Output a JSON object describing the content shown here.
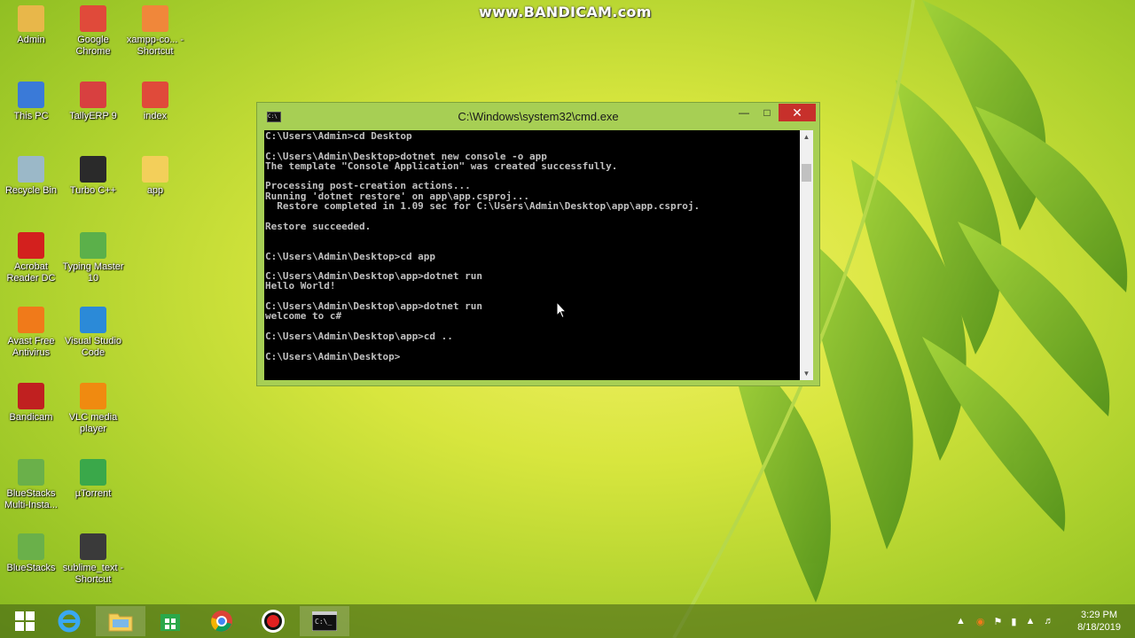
{
  "watermark": "www.BANDICAM.com",
  "desktop_icons": [
    {
      "label": "Admin",
      "icon": "user-folder-icon",
      "color": "#e8b74a"
    },
    {
      "label": "Google Chrome",
      "icon": "chrome-icon",
      "color": "#e04a3a"
    },
    {
      "label": "xampp-co... - Shortcut",
      "icon": "xampp-icon",
      "color": "#f0873a"
    },
    {
      "label": "This PC",
      "icon": "computer-icon",
      "color": "#3a7ad8"
    },
    {
      "label": "TallyERP 9",
      "icon": "tally-icon",
      "color": "#d84040"
    },
    {
      "label": "index",
      "icon": "chrome-icon",
      "color": "#e04a3a"
    },
    {
      "label": "Recycle Bin",
      "icon": "recycle-bin-icon",
      "color": "#9bb8c8"
    },
    {
      "label": "Turbo C++",
      "icon": "turbo-cpp-icon",
      "color": "#2a2a2a"
    },
    {
      "label": "app",
      "icon": "folder-icon",
      "color": "#f3cf5a"
    },
    {
      "label": "Acrobat Reader DC",
      "icon": "acrobat-icon",
      "color": "#d3201e"
    },
    {
      "label": "Typing Master 10",
      "icon": "typing-master-icon",
      "color": "#5bb04a"
    },
    {
      "label": "Avast Free Antivirus",
      "icon": "avast-icon",
      "color": "#f07a1a"
    },
    {
      "label": "Visual Studio Code",
      "icon": "vscode-icon",
      "color": "#2b8ad8"
    },
    {
      "label": "Bandicam",
      "icon": "bandicam-icon",
      "color": "#c02020"
    },
    {
      "label": "VLC media player",
      "icon": "vlc-icon",
      "color": "#f08a10"
    },
    {
      "label": "BlueStacks Multi-Insta...",
      "icon": "bluestacks-icon",
      "color": "#6ab04a"
    },
    {
      "label": "µTorrent",
      "icon": "utorrent-icon",
      "color": "#3aa84a"
    },
    {
      "label": "BlueStacks",
      "icon": "bluestacks-icon",
      "color": "#6ab04a"
    },
    {
      "label": "sublime_text - Shortcut",
      "icon": "sublime-icon",
      "color": "#3a3a3a"
    }
  ],
  "cmd": {
    "title": "C:\\Windows\\system32\\cmd.exe",
    "lines": [
      "C:\\Users\\Admin>cd Desktop",
      "",
      "C:\\Users\\Admin\\Desktop>dotnet new console -o app",
      "The template \"Console Application\" was created successfully.",
      "",
      "Processing post-creation actions...",
      "Running 'dotnet restore' on app\\app.csproj...",
      "  Restore completed in 1.09 sec for C:\\Users\\Admin\\Desktop\\app\\app.csproj.",
      "",
      "Restore succeeded.",
      "",
      "",
      "C:\\Users\\Admin\\Desktop>cd app",
      "",
      "C:\\Users\\Admin\\Desktop\\app>dotnet run",
      "Hello World!",
      "",
      "C:\\Users\\Admin\\Desktop\\app>dotnet run",
      "welcome to c#",
      "",
      "C:\\Users\\Admin\\Desktop\\app>cd ..",
      "",
      "C:\\Users\\Admin\\Desktop>"
    ]
  },
  "taskbar": {
    "items": [
      "start-icon",
      "internet-explorer-icon",
      "file-explorer-icon",
      "store-icon",
      "chrome-icon",
      "bandicam-record-icon",
      "cmd-icon"
    ],
    "clock": {
      "time": "3:29 PM",
      "date": "8/18/2019"
    }
  }
}
